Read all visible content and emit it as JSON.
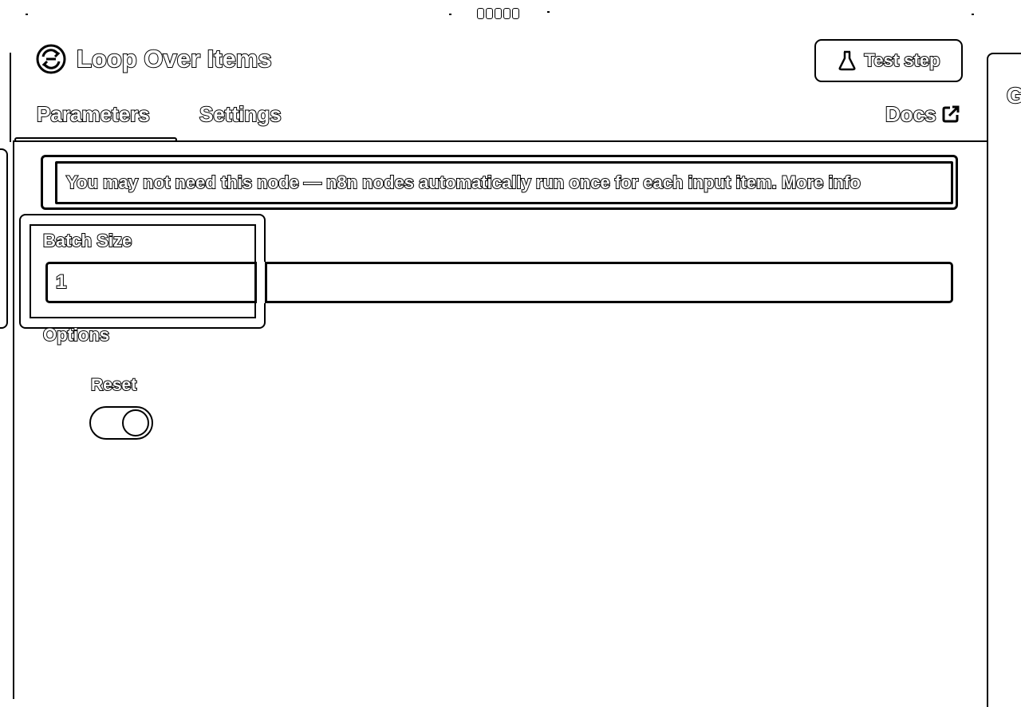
{
  "node": {
    "title": "Loop Over Items",
    "icon": "loop-arrows-icon"
  },
  "header": {
    "test_step_label": "Test step",
    "test_step_icon": "flask-icon"
  },
  "tabs": [
    {
      "label": "Parameters",
      "active": true
    },
    {
      "label": "Settings",
      "active": false
    }
  ],
  "docs": {
    "label": "Docs",
    "icon": "external-link-icon"
  },
  "notice": {
    "text": "You may not need this node — n8n nodes automatically run once for each input item.",
    "link_label": "More info"
  },
  "parameters": {
    "batch_size": {
      "label": "Batch Size",
      "value": "1"
    },
    "options": {
      "label": "Options",
      "reset": {
        "label": "Reset",
        "enabled": false
      }
    }
  },
  "right_panel": {
    "glyph": "G"
  }
}
